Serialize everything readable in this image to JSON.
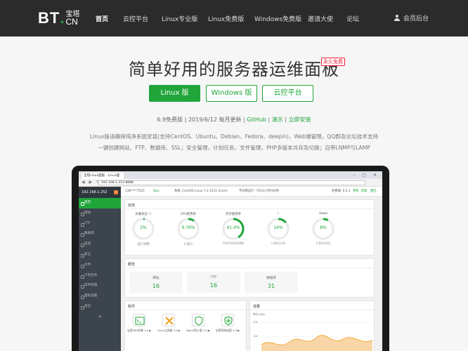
{
  "nav": {
    "logo_text": "BT",
    "logo_cn": "宝塔",
    "logo_suffix": "CN",
    "items": [
      {
        "label": "首页",
        "active": true
      },
      {
        "label": "云控平台"
      },
      {
        "label": "Linux专业版"
      },
      {
        "label": "Linux免费版"
      },
      {
        "label": "Windows免费版"
      },
      {
        "label": "邀请大使"
      },
      {
        "label": "论坛"
      }
    ],
    "login_label": "会员后台"
  },
  "hero": {
    "title": "简单好用的服务器运维面板",
    "badge": "永久免费",
    "buttons": {
      "linux": "Linux 版",
      "windows": "Windows 版",
      "cloud": "云控平台"
    },
    "meta": {
      "version": "6.9免费版",
      "sep1": " | ",
      "date": "2019/6/12 每月更新",
      "sep2": " | ",
      "github": "GitHub",
      "sep3": " | ",
      "demo": "演示",
      "sep4": " | ",
      "install": "立即安装"
    },
    "desc_line1": "Linux版请确保纯净系统安装(支持CentOS、Ubuntu、Debian、Fedora、deepin)，Web端管理，QQ群及论坛技术支持",
    "desc_line2": "一键创建网站、FTP、数据库、SSL；安全管理，计划任务，文件管理，PHP多版本共存及切换；自带LNMP与LAMP"
  },
  "screen": {
    "tab_title": "宝塔Linux面板 - Linux面",
    "window_controls": "– ▢ ✕",
    "addr_nav": "◀ ▶ ↻",
    "address": "192.168.1.212:8888",
    "sidebar_title": "192.168.1.252",
    "sidebar_badge": "0",
    "sidebar_items": [
      {
        "label": "首页",
        "active": true
      },
      {
        "label": "网站"
      },
      {
        "label": "FTP"
      },
      {
        "label": "数据库"
      },
      {
        "label": "监控"
      },
      {
        "label": "安全"
      },
      {
        "label": "文件"
      },
      {
        "label": "计划任务"
      },
      {
        "label": "软件管理"
      },
      {
        "label": "面板设置"
      },
      {
        "label": "退出"
      }
    ],
    "sidebar_plus": "+",
    "topbar": {
      "user": "138****7525",
      "status": "Qpo",
      "system": "系统: CentOS Linux 7.2.1511 (Core)",
      "uptime": "不间断运行: 7天21小时4分钟",
      "version": "免费版: 6.5.1",
      "update": "更新",
      "fix": "修复",
      "restart": "重启"
    },
    "status_card": {
      "title": "状态",
      "gauges": [
        {
          "label": "负载状态 ⓘ",
          "value": "2%",
          "sub": "运行流畅",
          "percent": 2
        },
        {
          "label": "CPU使用率",
          "value": "9.76%",
          "sub": "2 核心",
          "percent": 9.76
        },
        {
          "label": "内存使用率",
          "value": "41.4%",
          "sub": "759/1832(MB)",
          "percent": 41.4
        },
        {
          "label": "/",
          "value": "14%",
          "sub": "1.8G/13G",
          "percent": 14
        },
        {
          "label": "/www",
          "value": "8%",
          "sub": "1.8G/25G",
          "percent": 8
        }
      ]
    },
    "overview_card": {
      "title": "概览",
      "items": [
        {
          "label": "网站",
          "value": "16"
        },
        {
          "label": "FTP",
          "value": "16"
        },
        {
          "label": "数据库",
          "value": "31"
        }
      ]
    },
    "software_card": {
      "title": "软件",
      "items": [
        {
          "label": "宝塔SSH终端 1.0 ▶"
        },
        {
          "label": "Linux工具箱 1.0 ▶"
        },
        {
          "label": "Nginx防火墙 1.0 ▶"
        },
        {
          "label": "宝塔系统加固 1.0 ▶"
        }
      ]
    },
    "traffic_card": {
      "title": "流量",
      "unit": "单位:KB/s",
      "ticks": [
        "200",
        "100"
      ]
    }
  },
  "colors": {
    "accent": "#20a53a",
    "nav_bg": "#2b2b2b",
    "badge_red": "#e22233"
  }
}
